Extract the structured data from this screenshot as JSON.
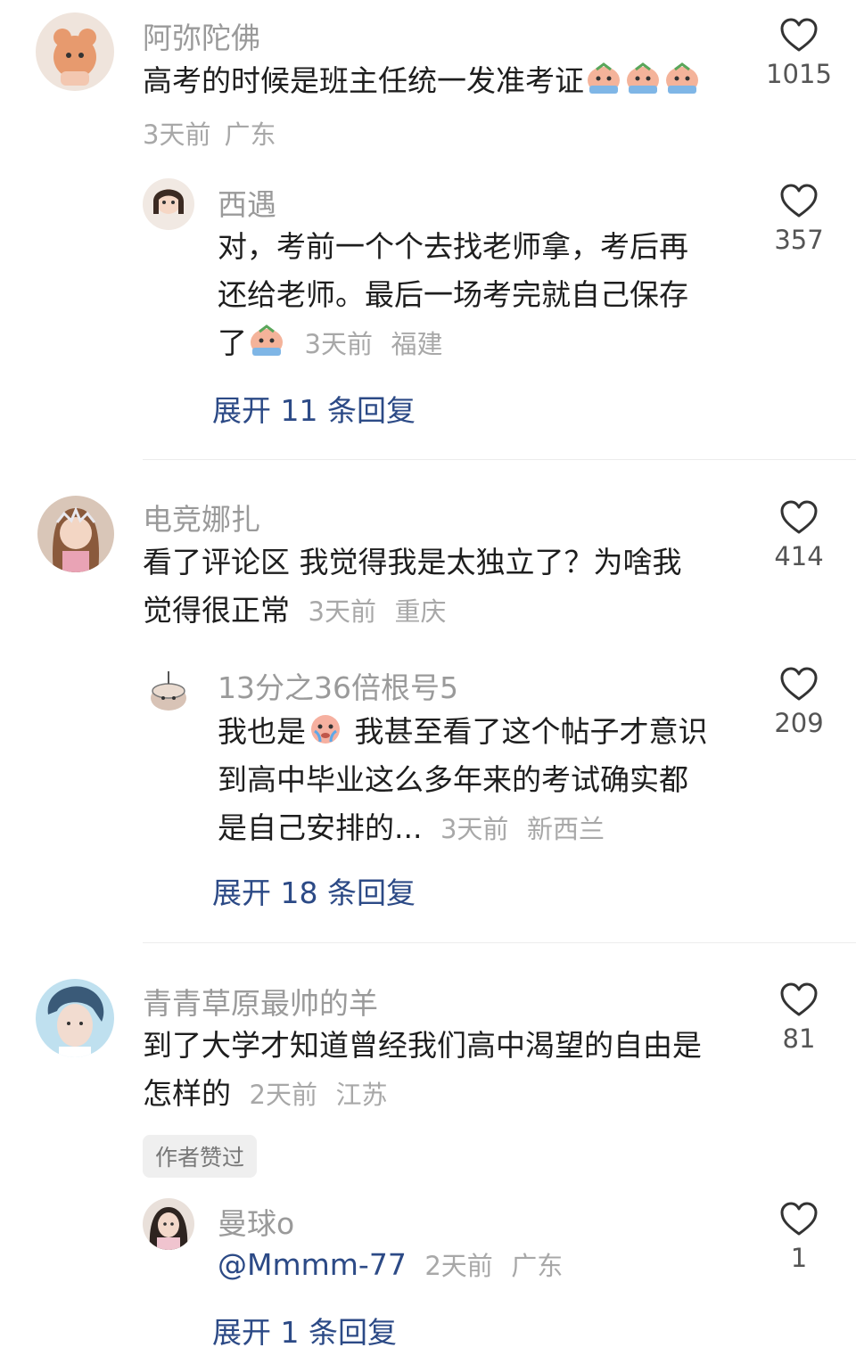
{
  "comments": [
    {
      "user": "阿弥陀佛",
      "text": "高考的时候是班主任统一发准考证",
      "time": "3天前",
      "location": "广东",
      "likes": "1015",
      "reply": {
        "user": "西遇",
        "line1": "对，考前一个个去找老师拿，考后再",
        "line2": "还给老师。最后一场考完就自己保存",
        "line3": "了",
        "time": "3天前",
        "location": "福建",
        "likes": "357"
      },
      "expand": "展开 11 条回复"
    },
    {
      "user": "电竞娜扎",
      "line1": "看了评论区 我觉得我是太独立了？为啥我",
      "line2": "觉得很正常",
      "time": "3天前",
      "location": "重庆",
      "likes": "414",
      "reply": {
        "user": "13分之36倍根号5",
        "line1a": "我也是",
        "line1b": "我甚至看了这个帖子才意识",
        "line2": "到高中毕业这么多年来的考试确实都",
        "line3": "是自己安排的...",
        "time": "3天前",
        "location": "新西兰",
        "likes": "209"
      },
      "expand": "展开 18 条回复"
    },
    {
      "user": "青青草原最帅的羊",
      "line1": "到了大学才知道曾经我们高中渴望的自由是",
      "line2": "怎样的",
      "time": "2天前",
      "location": "江苏",
      "likes": "81",
      "badge": "作者赞过",
      "reply": {
        "user": "曼球o",
        "mention": "@Mmmm-77",
        "time": "2天前",
        "location": "广东",
        "likes": "1"
      },
      "expand": "展开 1 条回复"
    }
  ],
  "icons": {
    "like": "heart-outline-icon",
    "emoji": "crying-face-emoji-icon"
  },
  "colors": {
    "username": "#9a9a9a",
    "text": "#1e1e1e",
    "meta": "#a8a8a8",
    "expand_link": "#2c4a86",
    "divider": "#ececec"
  }
}
